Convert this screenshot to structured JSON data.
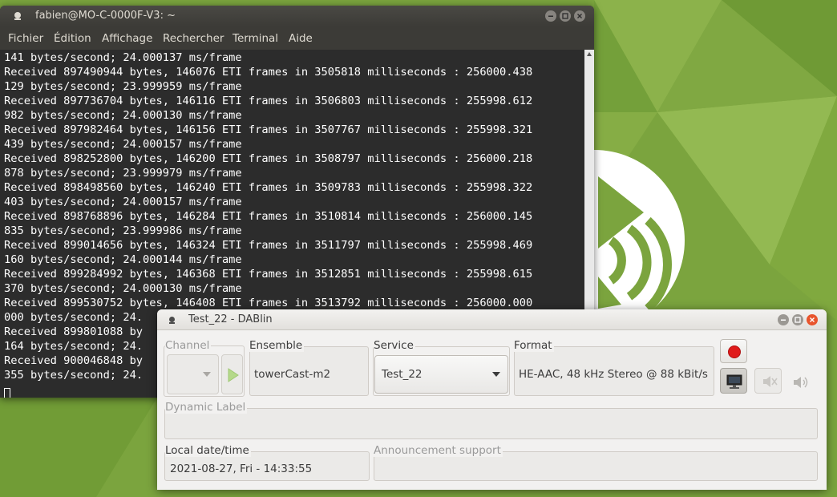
{
  "terminal": {
    "title": "fabien@MO-C-0000F-V3: ~",
    "menu": [
      "Fichier",
      "Édition",
      "Affichage",
      "Rechercher",
      "Terminal",
      "Aide"
    ],
    "lines": [
      "141 bytes/second; 24.000137 ms/frame",
      "Received 897490944 bytes, 146076 ETI frames in 3505818 milliseconds : 256000.438",
      "129 bytes/second; 23.999959 ms/frame",
      "Received 897736704 bytes, 146116 ETI frames in 3506803 milliseconds : 255998.612",
      "982 bytes/second; 24.000130 ms/frame",
      "Received 897982464 bytes, 146156 ETI frames in 3507767 milliseconds : 255998.321",
      "439 bytes/second; 24.000157 ms/frame",
      "Received 898252800 bytes, 146200 ETI frames in 3508797 milliseconds : 256000.218",
      "878 bytes/second; 23.999979 ms/frame",
      "Received 898498560 bytes, 146240 ETI frames in 3509783 milliseconds : 255998.322",
      "403 bytes/second; 24.000157 ms/frame",
      "Received 898768896 bytes, 146284 ETI frames in 3510814 milliseconds : 256000.145",
      "835 bytes/second; 23.999986 ms/frame",
      "Received 899014656 bytes, 146324 ETI frames in 3511797 milliseconds : 255998.469",
      "160 bytes/second; 24.000144 ms/frame",
      "Received 899284992 bytes, 146368 ETI frames in 3512851 milliseconds : 255998.615",
      "370 bytes/second; 24.000130 ms/frame",
      "Received 899530752 bytes, 146408 ETI frames in 3513792 milliseconds : 256000.000",
      "000 bytes/second; 24.",
      "Received 899801088 by",
      "164 bytes/second; 24.",
      "Received 900046848 by",
      "355 bytes/second; 24."
    ]
  },
  "dablin": {
    "title": "Test_22 - DABlin",
    "channel_label": "Channel",
    "ensemble_label": "Ensemble",
    "ensemble_value": "towerCast-m2",
    "service_label": "Service",
    "service_value": "Test_22",
    "format_label": "Format",
    "format_value": "HE-AAC, 48 kHz Stereo @ 88 kBit/s",
    "dynamic_label": "Dynamic Label",
    "dynamic_label_value": "",
    "local_datetime_label": "Local date/time",
    "local_datetime_value": "2021-08-27, Fri - 14:33:55",
    "announcement_label": "Announcement support",
    "announcement_value": ""
  },
  "icons": {
    "terminal_app": "app-dot-icon",
    "play": "play-icon",
    "record": "record-icon",
    "slideshow": "monitor-icon",
    "mute": "mute-icon",
    "volume": "speaker-icon"
  },
  "colors": {
    "desktop_green": "#7ba43e",
    "terminal_bg": "#2c2c2c",
    "record_red": "#e01b1b",
    "close_orange": "#e8542c"
  }
}
